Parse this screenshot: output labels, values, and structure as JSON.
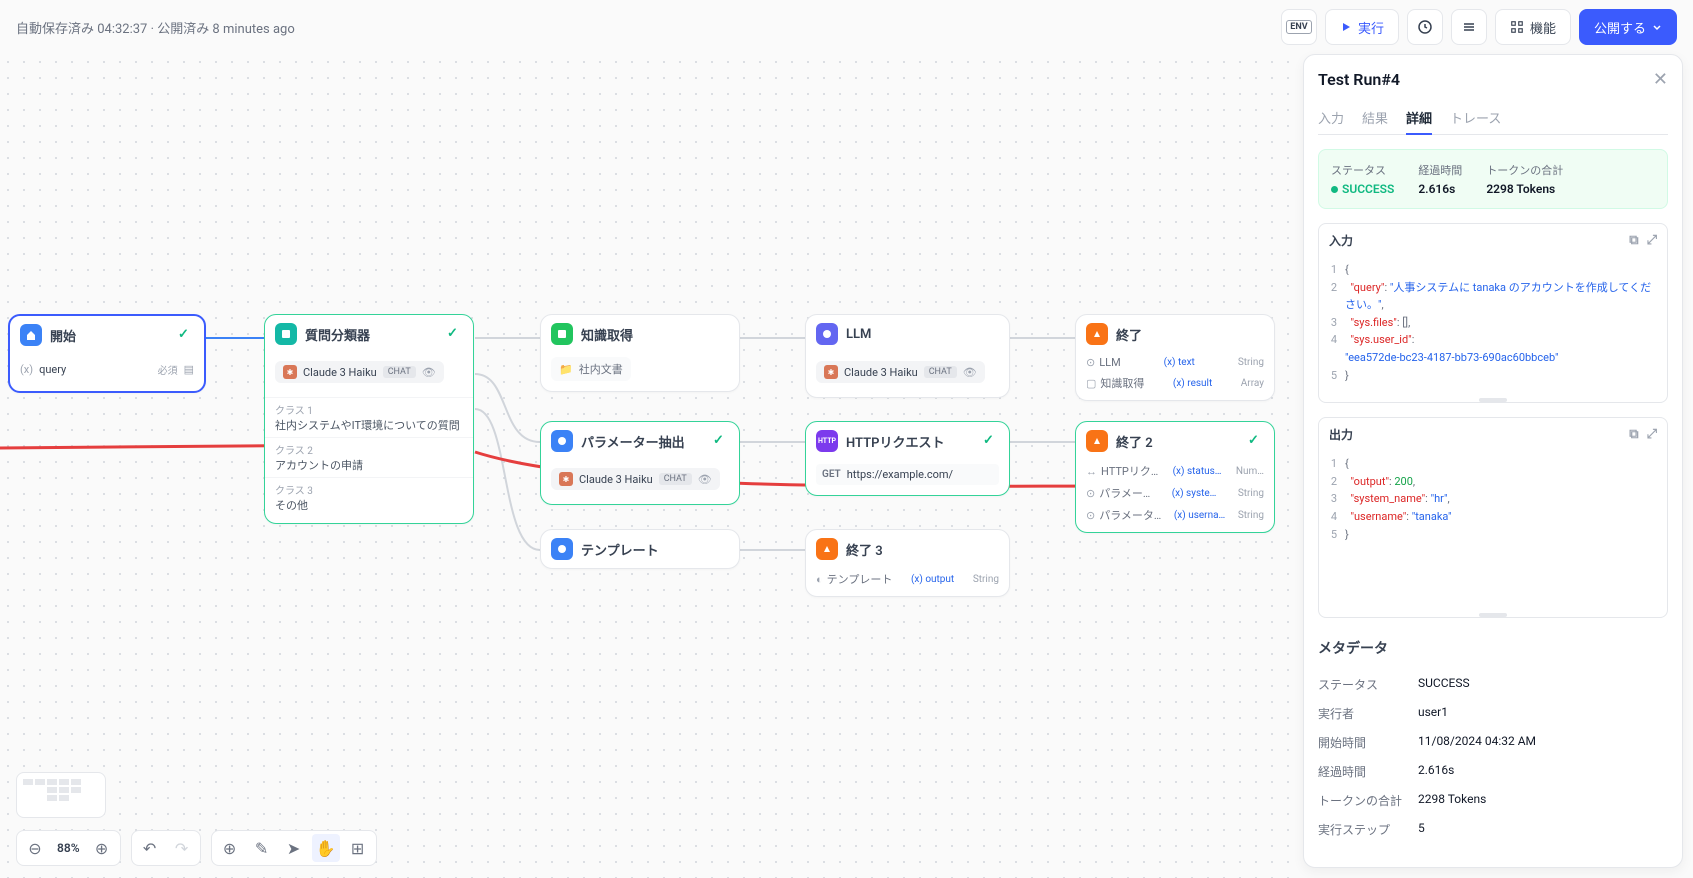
{
  "topbar": {
    "autosave": "自動保存済み 04:32:37 · 公開済み 8 minutes ago",
    "env": "ENV",
    "run": "実行",
    "features": "機能",
    "publish": "公開する"
  },
  "nodes": {
    "start": {
      "title": "開始",
      "var": "query",
      "req": "必須"
    },
    "classifier": {
      "title": "質問分類器",
      "model": "Claude 3 Haiku",
      "mode": "CHAT",
      "c1l": "クラス 1",
      "c1t": "社内システムやIT環境についての質問",
      "c2l": "クラス 2",
      "c2t": "アカウントの申請",
      "c3l": "クラス 3",
      "c3t": "その他"
    },
    "knowledge": {
      "title": "知識取得",
      "doc": "社内文書"
    },
    "llm": {
      "title": "LLM",
      "model": "Claude 3 Haiku",
      "mode": "CHAT"
    },
    "end1": {
      "title": "終了",
      "srcA": "LLM",
      "varA": "text",
      "typeA": "String",
      "srcB": "知識取得",
      "varB": "result",
      "typeB": "Array"
    },
    "param": {
      "title": "パラメーター抽出",
      "model": "Claude 3 Haiku",
      "mode": "CHAT"
    },
    "http": {
      "title": "HTTPリクエスト",
      "method": "GET",
      "url": "https://example.com/"
    },
    "end2": {
      "title": "終了 2",
      "r1s": "HTTPリク…",
      "r1v": "status…",
      "r1t": "Num…",
      "r2s": "パラメー…",
      "r2v": "syste…",
      "r2t": "String",
      "r3s": "パラメータ…",
      "r3v": "userna…",
      "r3t": "String"
    },
    "template": {
      "title": "テンプレート"
    },
    "end3": {
      "title": "終了 3",
      "src": "テンプレート",
      "var": "output",
      "type": "String"
    }
  },
  "panel": {
    "title": "Test Run#4",
    "tabs": {
      "input": "入力",
      "result": "結果",
      "detail": "詳細",
      "trace": "トレース"
    },
    "status": {
      "statusLabel": "ステータス",
      "statusVal": "SUCCESS",
      "timeLabel": "経過時間",
      "timeVal": "2.616s",
      "tokenLabel": "トークンの合計",
      "tokenVal": "2298 Tokens"
    },
    "input": {
      "title": "入力",
      "l1": "{",
      "l2a": "\"query\"",
      "l2b": ": ",
      "l2c": "\"人事システムに tanaka のアカウントを作成してください。\"",
      "l2d": ",",
      "l3a": "\"sys.files\"",
      "l3b": ": ",
      "l3c": "[]",
      "l3d": ",",
      "l4a": "\"sys.user_id\"",
      "l4b": ":",
      "l4c": "\"eea572de-bc23-4187-bb73-690ac60bbceb\"",
      "l5": "}"
    },
    "output": {
      "title": "出力",
      "l1": "{",
      "l2a": "\"output\"",
      "l2b": ": ",
      "l2c": "200",
      "l2d": ",",
      "l3a": "\"system_name\"",
      "l3b": ": ",
      "l3c": "\"hr\"",
      "l3d": ",",
      "l4a": "\"username\"",
      "l4b": ": ",
      "l4c": "\"tanaka\"",
      "l5": "}"
    },
    "meta": {
      "title": "メタデータ",
      "statusK": "ステータス",
      "statusV": "SUCCESS",
      "userK": "実行者",
      "userV": "user1",
      "startK": "開始時間",
      "startV": "11/08/2024 04:32 AM",
      "elapsedK": "経過時間",
      "elapsedV": "2.616s",
      "tokenK": "トークンの合計",
      "tokenV": "2298 Tokens",
      "stepsK": "実行ステップ",
      "stepsV": "5"
    }
  },
  "controls": {
    "zoom": "88%"
  }
}
